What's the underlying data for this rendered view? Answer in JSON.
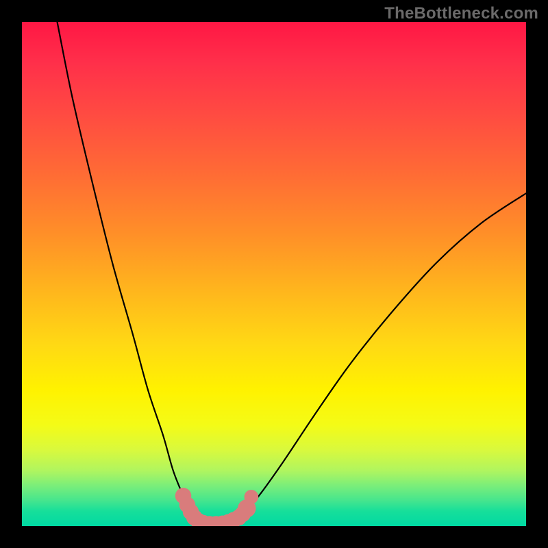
{
  "watermark": "TheBottleneck.com",
  "colors": {
    "background": "#000000",
    "gradient_top": "#ff1744",
    "gradient_mid": "#fff200",
    "gradient_bottom": "#00d9a3",
    "curve": "#000000",
    "marker": "#d97c7c"
  },
  "chart_data": {
    "type": "line",
    "title": "",
    "xlabel": "",
    "ylabel": "",
    "xlim": [
      0,
      100
    ],
    "ylim": [
      0,
      100
    ],
    "grid": false,
    "series": [
      {
        "name": "left-branch",
        "x": [
          7,
          10,
          14,
          18,
          22,
          25,
          28,
          30,
          32,
          33.5,
          34.5
        ],
        "y": [
          100,
          85,
          68,
          52,
          38,
          27,
          18,
          11,
          6,
          3,
          1.5
        ]
      },
      {
        "name": "valley-floor",
        "x": [
          34.5,
          36,
          38,
          40,
          42,
          43.5
        ],
        "y": [
          1.5,
          0.7,
          0.4,
          0.5,
          1.0,
          2.0
        ]
      },
      {
        "name": "right-branch",
        "x": [
          43.5,
          47,
          52,
          58,
          65,
          73,
          82,
          91,
          100
        ],
        "y": [
          2.0,
          6,
          13,
          22,
          32,
          42,
          52,
          60,
          66
        ]
      }
    ],
    "markers": [
      {
        "x": 32.0,
        "y": 6.0,
        "r": 1.6
      },
      {
        "x": 32.8,
        "y": 4.2,
        "r": 1.6
      },
      {
        "x": 33.5,
        "y": 2.8,
        "r": 1.6
      },
      {
        "x": 34.2,
        "y": 1.7,
        "r": 1.6
      },
      {
        "x": 35.0,
        "y": 1.0,
        "r": 1.6
      },
      {
        "x": 36.0,
        "y": 0.6,
        "r": 1.6
      },
      {
        "x": 37.2,
        "y": 0.4,
        "r": 1.6
      },
      {
        "x": 38.5,
        "y": 0.4,
        "r": 1.6
      },
      {
        "x": 39.8,
        "y": 0.5,
        "r": 1.6
      },
      {
        "x": 41.0,
        "y": 0.8,
        "r": 1.6
      },
      {
        "x": 42.0,
        "y": 1.2,
        "r": 1.6
      },
      {
        "x": 43.0,
        "y": 1.7,
        "r": 1.6
      },
      {
        "x": 43.8,
        "y": 2.4,
        "r": 1.6
      },
      {
        "x": 44.6,
        "y": 3.5,
        "r": 1.8
      },
      {
        "x": 45.5,
        "y": 5.8,
        "r": 1.4
      }
    ],
    "annotations": []
  }
}
